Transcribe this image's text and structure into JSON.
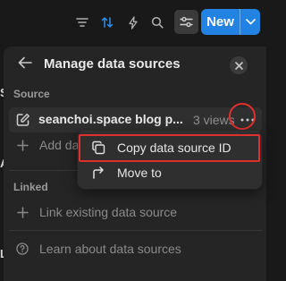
{
  "toolbar": {
    "icons": [
      "filter-icon",
      "sort-icon",
      "automation-bolt-icon",
      "search-icon",
      "settings-sliders-icon"
    ],
    "new_label": "New",
    "accent": "#2383e2"
  },
  "left_edge": {
    "chars": [
      "S",
      "A",
      "L"
    ]
  },
  "panel": {
    "title": "Manage data sources",
    "source_section_label": "Source",
    "source": {
      "name": "seanchoi.space blog p...",
      "views": "3 views"
    },
    "add_label": "Add da",
    "linked_section_label": "Linked",
    "link_existing_label": "Link existing data source",
    "learn_label": "Learn about data sources"
  },
  "context_menu": {
    "items": [
      {
        "label": "Copy data source ID",
        "icon": "copy-icon"
      },
      {
        "label": "Move to",
        "icon": "move-arrow-icon"
      }
    ]
  },
  "highlight_color": "#e0302d"
}
